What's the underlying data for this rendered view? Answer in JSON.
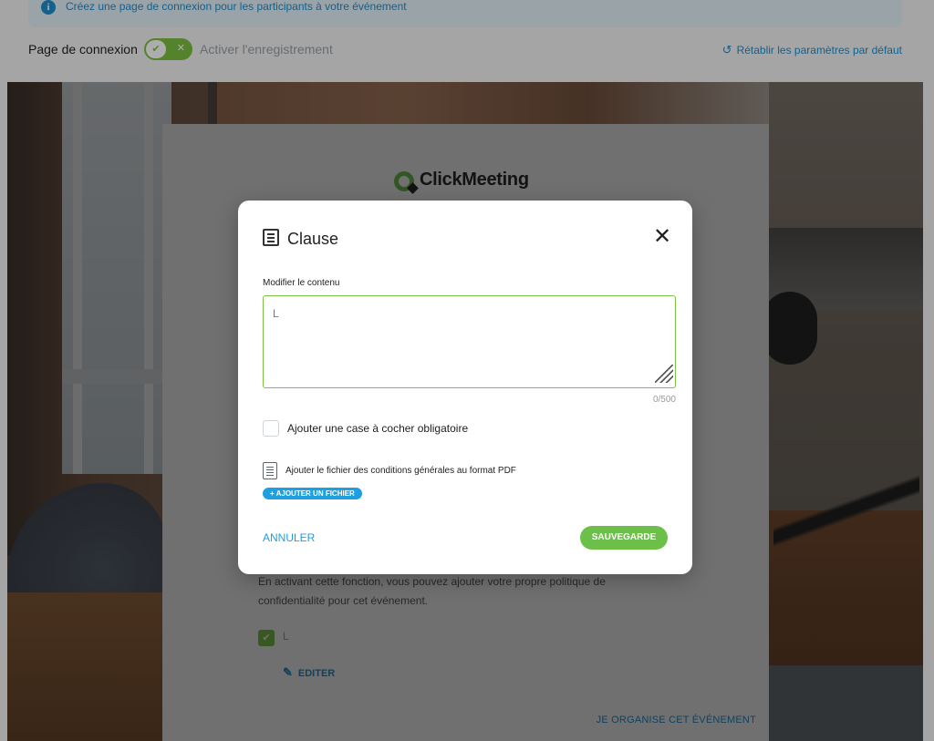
{
  "info_banner": {
    "text": "Créez une page de connexion pour les participants à votre événement",
    "icon": "info-icon"
  },
  "settings": {
    "login_page_label": "Page de connexion",
    "toggle_on": true,
    "enable_recording_label": "Activer l'enregistrement",
    "reset_label": "Rétablir les paramètres par défaut",
    "accent_color": "#1d8fd0",
    "toggle_color": "#7cc242"
  },
  "card": {
    "logo_text": "ClickMeeting",
    "description": "En activant cette fonction, vous pouvez ajouter votre propre politique de confidentialité pour cet événement.",
    "checkbox_label": "L",
    "checkbox_checked": true,
    "edit_label": "EDITER",
    "organize_link": "JE ORGANISE CET ÉVÉNEMENT"
  },
  "modal": {
    "title": "Clause",
    "title_icon": "document-icon",
    "content_label": "Modifier le contenu",
    "textarea_value": "L",
    "char_counter": "0/500",
    "mandatory_checkbox_label": "Ajouter une case à cocher obligatoire",
    "mandatory_checked": false,
    "pdf_label": "Ajouter le fichier des conditions générales au format PDF",
    "add_file_button": "+ AJOUTER UN FICHIER",
    "cancel_button": "ANNULER",
    "save_button": "SAUVEGARDE",
    "save_color": "#6cc04a"
  }
}
